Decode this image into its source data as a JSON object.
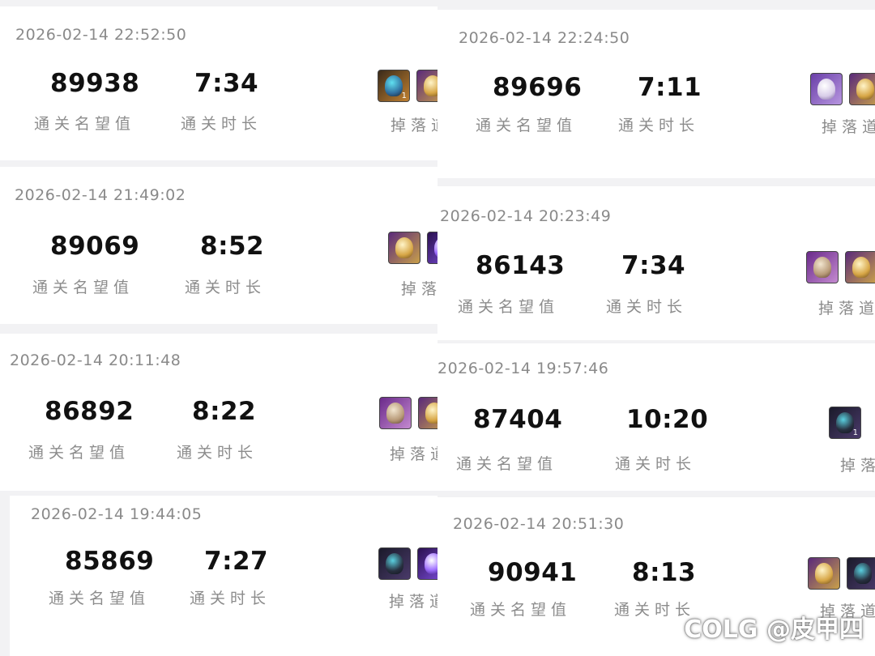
{
  "labels": {
    "score": "通关名望值",
    "duration": "通关时长",
    "drops": "掉落道"
  },
  "records": [
    {
      "timestamp": "2026-02-14 22:52:50",
      "score": "89938",
      "duration": "7:34",
      "drop_label": "掉落道",
      "items": [
        {
          "icon": "boots-icon",
          "count": "1"
        },
        {
          "icon": "gold-armor-icon"
        }
      ]
    },
    {
      "timestamp": "2026-02-14 22:24:50",
      "score": "89696",
      "duration": "7:11",
      "drop_label": "掉落道",
      "items": [
        {
          "icon": "white-cloth-icon"
        },
        {
          "icon": "gold-armor-icon"
        }
      ]
    },
    {
      "timestamp": "2026-02-14 21:49:02",
      "score": "89069",
      "duration": "8:52",
      "drop_label": "掉落",
      "items": [
        {
          "icon": "gold-armor-icon"
        },
        {
          "icon": "purple-item-icon"
        }
      ]
    },
    {
      "timestamp": "2026-02-14 20:23:49",
      "score": "86143",
      "duration": "7:34",
      "drop_label": "掉落道",
      "items": [
        {
          "icon": "gold-cloak-icon"
        },
        {
          "icon": "gold-armor-icon"
        }
      ]
    },
    {
      "timestamp": "2026-02-14 20:11:48",
      "score": "86892",
      "duration": "8:22",
      "drop_label": "掉落道",
      "items": [
        {
          "icon": "cloak-icon"
        },
        {
          "icon": "gold-armor-icon"
        }
      ]
    },
    {
      "timestamp": "2026-02-14 19:57:46",
      "score": "87404",
      "duration": "10:20",
      "drop_label": "掉落",
      "items": [
        {
          "icon": "dark-helmet-icon",
          "count": "1"
        }
      ]
    },
    {
      "timestamp": "2026-02-14 19:44:05",
      "score": "85869",
      "duration": "7:27",
      "drop_label": "掉落道",
      "items": [
        {
          "icon": "dark-armor-icon"
        },
        {
          "icon": "orb-icon"
        }
      ]
    },
    {
      "timestamp": "2026-02-14 20:51:30",
      "score": "90941",
      "duration": "8:13",
      "drop_label": "掉落道",
      "items": [
        {
          "icon": "gold-armor-icon"
        },
        {
          "icon": "dark-helmet-icon"
        }
      ]
    }
  ],
  "watermark": "COLG @皮甲四"
}
